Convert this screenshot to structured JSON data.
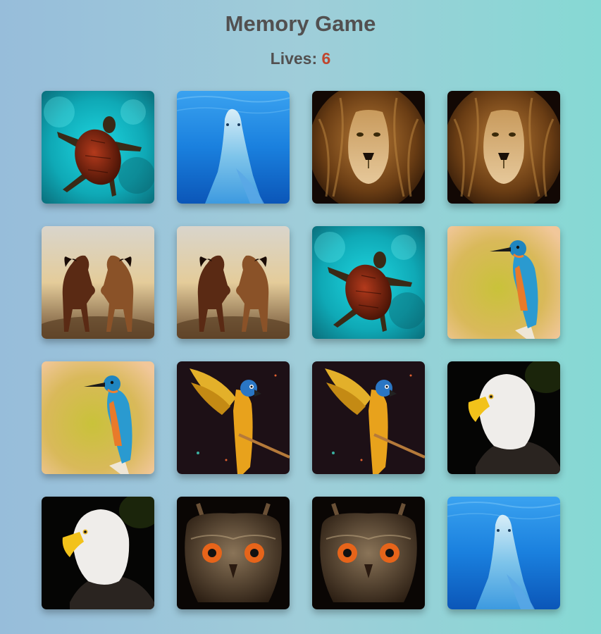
{
  "header": {
    "title": "Memory Game",
    "lives_label": "Lives:",
    "lives_count": "6"
  },
  "cards": [
    {
      "animal": "turtle"
    },
    {
      "animal": "dolphin"
    },
    {
      "animal": "lion"
    },
    {
      "animal": "lion"
    },
    {
      "animal": "horses"
    },
    {
      "animal": "horses"
    },
    {
      "animal": "turtle"
    },
    {
      "animal": "kingfisher"
    },
    {
      "animal": "kingfisher"
    },
    {
      "animal": "parrot"
    },
    {
      "animal": "parrot"
    },
    {
      "animal": "eagle"
    },
    {
      "animal": "eagle"
    },
    {
      "animal": "owl"
    },
    {
      "animal": "owl"
    },
    {
      "animal": "dolphin"
    }
  ],
  "colors": {
    "title": "#525050",
    "lives_count": "#c0462e"
  }
}
